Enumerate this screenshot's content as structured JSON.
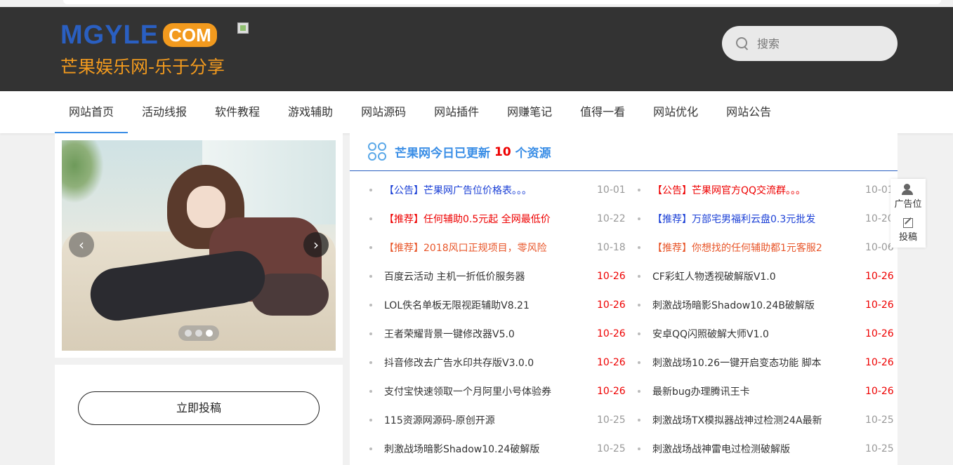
{
  "header": {
    "logo_main": "MGYLE",
    "logo_com": "COM",
    "logo_sub": "芒果娱乐网-乐于分享",
    "search_placeholder": "搜索"
  },
  "nav": {
    "items": [
      "网站首页",
      "活动线报",
      "软件教程",
      "游戏辅助",
      "网站源码",
      "网站插件",
      "网赚笔记",
      "值得一看",
      "网站优化",
      "网站公告"
    ],
    "active_index": 0
  },
  "slider": {
    "prev_label": "‹",
    "next_label": "›",
    "dot_count": 3,
    "active_dot": 2
  },
  "submit": {
    "button_label": "立即投稿"
  },
  "main": {
    "title_prefix": "芒果网今日已更新",
    "count": "10",
    "title_suffix": "个资源",
    "left_list": [
      {
        "title": "【公告】芒果网广告位价格表。。。",
        "date": "10-01",
        "color": "blue"
      },
      {
        "title": "【推荐】任何辅助0.5元起 全网最低价",
        "date": "10-22",
        "color": "red"
      },
      {
        "title": "【推荐】2018风口正规项目，零风险",
        "date": "10-18",
        "color": "orange"
      },
      {
        "title": "百度云活动 主机一折低价服务器",
        "date": "10-26",
        "color": "",
        "new": true
      },
      {
        "title": "LOL佚名单板无限视距辅助V8.21",
        "date": "10-26",
        "color": "",
        "new": true
      },
      {
        "title": "王者荣耀背景一键修改器V5.0",
        "date": "10-26",
        "color": "",
        "new": true
      },
      {
        "title": "抖音修改去广告水印共存版V3.0.0",
        "date": "10-26",
        "color": "",
        "new": true
      },
      {
        "title": "支付宝快速领取一个月阿里小号体验券",
        "date": "10-26",
        "color": "",
        "new": true
      },
      {
        "title": "115资源网源码-原创开源",
        "date": "10-25",
        "color": ""
      },
      {
        "title": "刺激战场暗影Shadow10.24破解版",
        "date": "10-25",
        "color": ""
      }
    ],
    "right_list": [
      {
        "title": "【公告】芒果网官方QQ交流群。。。",
        "date": "10-01",
        "color": "red"
      },
      {
        "title": "【推荐】万部宅男福利云盘0.3元批发",
        "date": "10-20",
        "color": "blue"
      },
      {
        "title": "【推荐】你想找的任何辅助都1元客服2",
        "date": "10-06",
        "color": "orange"
      },
      {
        "title": "CF彩虹人物透视破解版V1.0",
        "date": "10-26",
        "color": "",
        "new": true
      },
      {
        "title": "刺激战场暗影Shadow10.24B破解版",
        "date": "10-26",
        "color": "",
        "new": true
      },
      {
        "title": "安卓QQ闪照破解大师V1.0",
        "date": "10-26",
        "color": "",
        "new": true
      },
      {
        "title": "刺激战场10.26一键开启变态功能 脚本",
        "date": "10-26",
        "color": "",
        "new": true
      },
      {
        "title": "最新bug办理腾讯王卡",
        "date": "10-26",
        "color": "",
        "new": true
      },
      {
        "title": "刺激战场TX模拟器战神过检测24A最新",
        "date": "10-25",
        "color": ""
      },
      {
        "title": "刺激战场战神雷电过检测破解版",
        "date": "10-25",
        "color": ""
      }
    ]
  },
  "float_bar": {
    "ad_label": "广告位",
    "submit_label": "投稿"
  }
}
